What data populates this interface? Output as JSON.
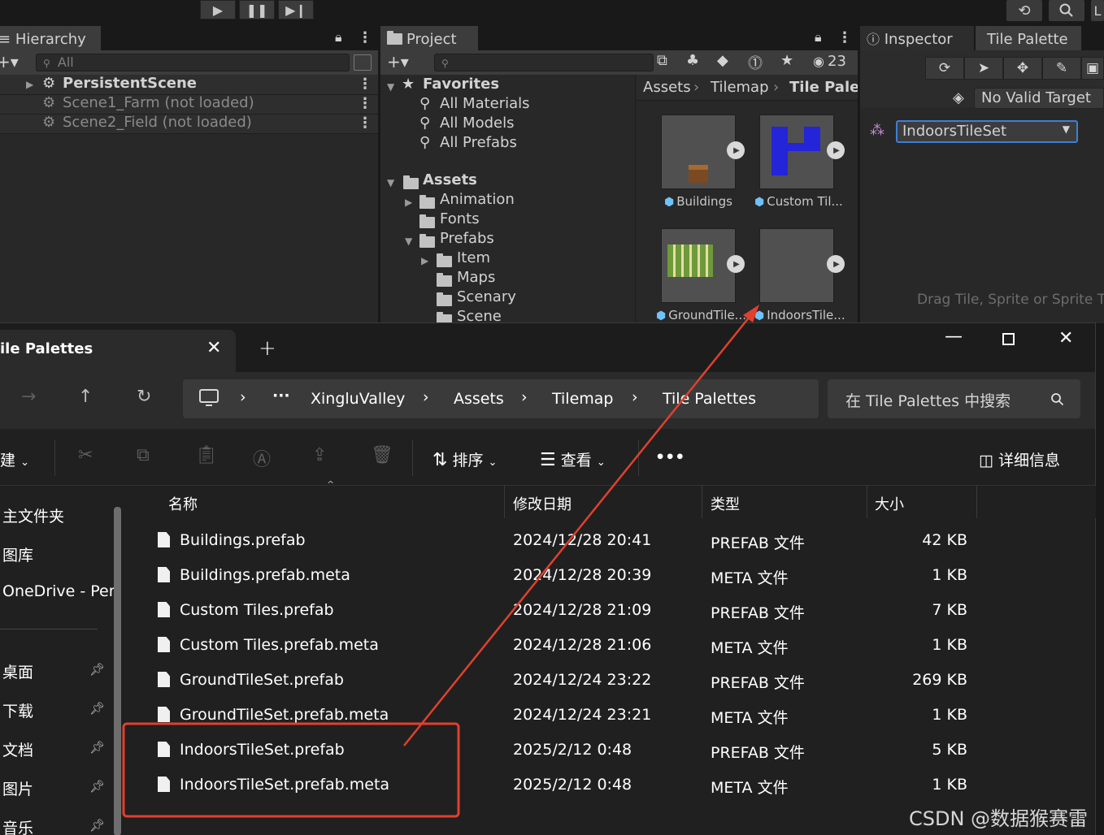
{
  "unity": {
    "hierarchy": {
      "tab": "Hierarchy",
      "search_placeholder": "All",
      "scenes": [
        "PersistentScene",
        "Scene1_Farm (not loaded)",
        "Scene2_Field (not loaded)"
      ]
    },
    "project": {
      "tab": "Project",
      "hidden_count": "23",
      "favorites_label": "Favorites",
      "favorites": [
        "All Materials",
        "All Models",
        "All Prefabs"
      ],
      "assets_label": "Assets",
      "assets": [
        "Animation",
        "Fonts",
        "Prefabs"
      ],
      "prefabs_children": [
        "Item",
        "Maps",
        "Scenary",
        "Scene"
      ],
      "breadcrumb": [
        "Assets",
        "Tilemap",
        "Tile Palet"
      ],
      "items": [
        "Buildings",
        "Custom Til...",
        "GroundTile...",
        "IndoorsTile..."
      ]
    },
    "inspector_tab": "Inspector",
    "tile_palette": {
      "tab": "Tile Palette",
      "target": "No Valid Target",
      "palette_dropdown": "IndoorsTileSet",
      "hint": "Drag Tile, Sprite or Sprite T"
    }
  },
  "explorer": {
    "tab_title": "ile Palettes",
    "breadcrumb": [
      "XingluValley",
      "Assets",
      "Tilemap",
      "Tile Palettes"
    ],
    "more_crumbs": "···",
    "search_placeholder": "在 Tile Palettes 中搜索",
    "toolbar": {
      "new_label": "建",
      "sort_label": "排序",
      "view_label": "查看",
      "more": "•••",
      "details_label": "详细信息"
    },
    "sidebar": {
      "items": [
        "主文件夹",
        "图库",
        "OneDrive - Per"
      ],
      "pinned": [
        "桌面",
        "下载",
        "文档",
        "图片",
        "音乐"
      ]
    },
    "columns": [
      "名称",
      "修改日期",
      "类型",
      "大小"
    ],
    "files": [
      {
        "name": "Buildings.prefab",
        "date": "2024/12/28 20:41",
        "type": "PREFAB 文件",
        "size": "42 KB"
      },
      {
        "name": "Buildings.prefab.meta",
        "date": "2024/12/28 20:39",
        "type": "META 文件",
        "size": "1 KB"
      },
      {
        "name": "Custom Tiles.prefab",
        "date": "2024/12/28 21:09",
        "type": "PREFAB 文件",
        "size": "7 KB"
      },
      {
        "name": "Custom Tiles.prefab.meta",
        "date": "2024/12/28 21:06",
        "type": "META 文件",
        "size": "1 KB"
      },
      {
        "name": "GroundTileSet.prefab",
        "date": "2024/12/24 23:22",
        "type": "PREFAB 文件",
        "size": "269 KB"
      },
      {
        "name": "GroundTileSet.prefab.meta",
        "date": "2024/12/24 23:21",
        "type": "META 文件",
        "size": "1 KB"
      },
      {
        "name": "IndoorsTileSet.prefab",
        "date": "2025/2/12 0:48",
        "type": "PREFAB 文件",
        "size": "5 KB"
      },
      {
        "name": "IndoorsTileSet.prefab.meta",
        "date": "2025/2/12 0:48",
        "type": "META 文件",
        "size": "1 KB"
      }
    ]
  },
  "watermark": "CSDN @数据猴赛雷",
  "colors": {
    "annotation_red": "#e0402e",
    "unity_panel": "#282828",
    "explorer_bg": "#202020",
    "dropdown_border": "#3d7fd6"
  }
}
